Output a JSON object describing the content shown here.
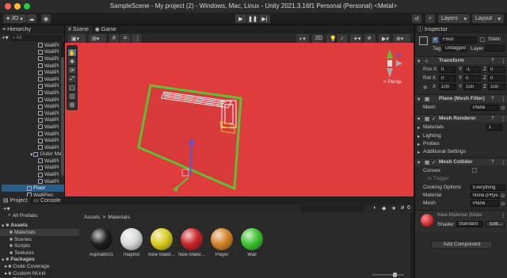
{
  "window": {
    "title": "SampleScene - My project (2) - Windows, Mac, Linux - Unity 2021.3.16f1 Personal (Personal) <Metal>"
  },
  "toolbar": {
    "account_label": "JO",
    "layers_label": "Layers",
    "layout_label": "Layout"
  },
  "hierarchy": {
    "tab_label": "Hierarchy",
    "search_placeholder": "All",
    "items": [
      {
        "label": "WallPi"
      },
      {
        "label": "WallPi"
      },
      {
        "label": "WallPi"
      },
      {
        "label": "WallPi"
      },
      {
        "label": "WallPi"
      },
      {
        "label": "WallPi"
      },
      {
        "label": "WallPi"
      },
      {
        "label": "WallPi"
      },
      {
        "label": "WallPi"
      },
      {
        "label": "WallPi"
      },
      {
        "label": "WallPi"
      },
      {
        "label": "WallPi"
      },
      {
        "label": "WallPi"
      },
      {
        "label": "WallPi"
      },
      {
        "label": "WallPi"
      },
      {
        "label": "WallPi"
      },
      {
        "label": "Outer Ma"
      },
      {
        "label": "WallPi"
      },
      {
        "label": "WallPi"
      },
      {
        "label": "WallPi"
      },
      {
        "label": "WallPi"
      },
      {
        "label": "Floor"
      },
      {
        "label": "WallPiec"
      }
    ]
  },
  "scene": {
    "tabs": [
      "Scene",
      "Game"
    ],
    "gizmo_label": "< Persp"
  },
  "inspector": {
    "tab_label": "Inspector",
    "object_name": "Floor",
    "static_label": "Static",
    "tag_label": "Tag",
    "tag_value": "Untagged",
    "layer_label": "Layer",
    "transform": {
      "title": "Transform",
      "pos_label": "Pos X",
      "rot_label": "Rot X",
      "scale_label": "X",
      "pos": [
        "0",
        "-1",
        "0"
      ],
      "rot": [
        "0",
        "0",
        "0"
      ],
      "scale": [
        "100",
        "100",
        "100"
      ],
      "axis_y": "Y",
      "axis_z": "Z",
      "axis_x": "X"
    },
    "mesh_filter": {
      "title": "Plane (Mesh Filter)",
      "mesh_label": "Mesh",
      "mesh_value": "Plane"
    },
    "mesh_renderer": {
      "title": "Mesh Renderer",
      "materials": "Materials",
      "materials_count": "1",
      "lighting": "Lighting",
      "probes": "Probes",
      "additional": "Additional Settings"
    },
    "mesh_collider": {
      "title": "Mesh Collider",
      "convex": "Convex",
      "is_trigger": "Is Trigger",
      "cooking": "Cooking Options",
      "cooking_value": "Everything",
      "material": "Material",
      "material_value": "None (Physi",
      "mesh": "Mesh",
      "mesh_value": "Plane"
    },
    "material": {
      "name": "New Material (Mate",
      "shader_label": "Shader",
      "shader_value": "Standard",
      "edit_label": "Edit..."
    },
    "add_component": "Add Component"
  },
  "bottom": {
    "tabs": [
      "Project",
      "Console"
    ],
    "count_label": "6",
    "project_tree": {
      "all_prefabs": "All Prefabs",
      "assets": "Assets",
      "folders": [
        "Materials",
        "Scenes",
        "Scripts",
        "Textures"
      ],
      "packages": "Packages",
      "package_items": [
        "Code Coverage",
        "Custom NUnit",
        "Editor Coroutines"
      ]
    },
    "breadcrumb": [
      "Assets",
      ">",
      "Materials"
    ],
    "assets": [
      {
        "label": "Asphalt001",
        "color": "#1e1e1e"
      },
      {
        "label": "mapmd",
        "color": "#d8d8d8"
      },
      {
        "label": "New Mater...",
        "color": "#d8cc22"
      },
      {
        "label": "New Mater...",
        "color": "#c8262a"
      },
      {
        "label": "Player",
        "color": "#d48328"
      },
      {
        "label": "Wall",
        "color": "#3fc232"
      }
    ]
  },
  "colors": {
    "viewport_bg": "#de3d3b",
    "selection": "#2c5d87",
    "maze_outline": "#5fc035"
  }
}
